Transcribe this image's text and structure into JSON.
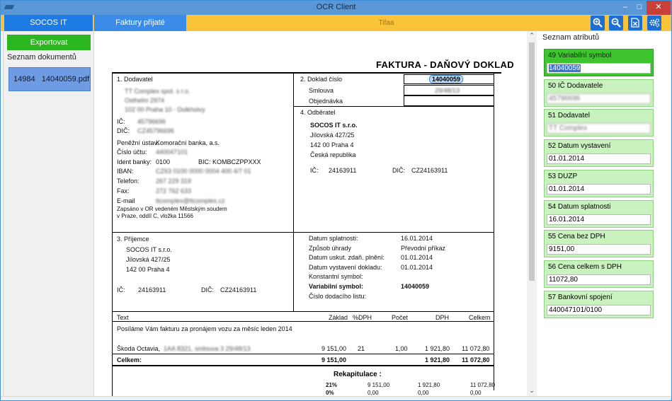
{
  "window": {
    "title": "OCR Client"
  },
  "tabs": [
    "SOCOS IT",
    "Faktury přijaté",
    "Tifaa"
  ],
  "toolbar": {
    "icons": [
      "zoom-in-icon",
      "zoom-out-icon",
      "excel-icon",
      "settings-icon"
    ]
  },
  "left": {
    "export_label": "Exportovat",
    "list_header": "Seznam dokumentů",
    "documents": [
      {
        "id": "14984",
        "name": "14040059.pdf"
      }
    ]
  },
  "invoice": {
    "title": "FAKTURA - DAŇOVÝ DOKLAD",
    "sec1": "1. Dodavatel",
    "sup_name": "TT Complex spol. s r.o.",
    "sup_street": "Osthelm 2974",
    "sup_city": "102 00 Praha 10 - Dolkholvy",
    "ic_lbl": "IČ:",
    "sup_ic": "45796696",
    "dic_lbl": "DIČ:",
    "sup_dic": "CZ45796696",
    "bank_lbl": "Peněžní ústav:",
    "bank_val": "Komorační banka, a.s.",
    "acc_lbl": "Číslo účtu:",
    "acc_val": "440047101",
    "ident_lbl": "Ident banky:",
    "ident_val": "0100",
    "bic_lbl": "BIC:",
    "bic_val": "KOMBCZPPXXX",
    "iban_lbl": "IBAN:",
    "iban_val": "CZ63 0100 0000 0004 400 4/7 01",
    "tel_lbl": "Telefon:",
    "tel_val": "267 229 319",
    "fax_lbl": "Fax:",
    "fax_val": "272 762 633",
    "mail_lbl": "E-mail",
    "mail_val": "ttcomplex@ttcomplex.cz",
    "reg1": "Zapsáno v OR vedeném Městským soudem",
    "reg2": "v Praze, oddíl C, vložka 11566",
    "sec2": "2. Doklad číslo",
    "doc_no": "14040059",
    "smlouva": "Smlouva",
    "smlouva_val": "29/48/13",
    "objednavka": "Objednávka",
    "sec4": "4. Odběratel",
    "cust_name": "SOCOS IT s.r.o.",
    "cust_street": "Jílovská 427/25",
    "cust_city": "142 00      Praha 4",
    "cust_country": "Česká republika",
    "cust_ic_lbl": "IČ:",
    "cust_ic": "24163911",
    "cust_dic_lbl": "DIČ:",
    "cust_dic": "CZ24163911",
    "sec3": "3. Příjemce",
    "rec_name": "SOCOS IT s.r.o.",
    "rec_street": "Jílovská  427/25",
    "rec_city": "142 00      Praha 4",
    "rec_ic_lbl": "IČ:",
    "rec_ic": "24163911",
    "rec_dic_lbl": "DIČ:",
    "rec_dic": "CZ24163911",
    "pay": [
      {
        "label": "Datum splatnosti:",
        "value": "16.01.2014",
        "bold": false
      },
      {
        "label": "Způsob úhrady",
        "value": "Převodní příkaz",
        "bold": false
      },
      {
        "label": "Datum uskut. zdaň. plnění:",
        "value": "01.01.2014",
        "bold": false
      },
      {
        "label": "Datum vystavení dokladu:",
        "value": "01.01.2014",
        "bold": false
      },
      {
        "label": "Konstantní symbol:",
        "value": "",
        "bold": false
      },
      {
        "label": "Variabilní symbol:",
        "value": "14040059",
        "bold": true
      },
      {
        "label": "Číslo dodacího listu:",
        "value": "",
        "bold": false
      }
    ],
    "cols": {
      "text": "Text",
      "zaklad": "Základ",
      "dph_pct": "%DPH",
      "pocet": "Počet",
      "dph": "DPH",
      "celkem": "Celkem"
    },
    "desc": "Posíláme Vám fakturu za pronájem vozu za měsíc leden 2014",
    "item_name": "Škoda Octavia,",
    "item_blur": "1AA 8321, smlouva 3 29/48/13",
    "item_zaklad": "9 151,00",
    "item_pct": "21",
    "item_pocet": "1,00",
    "item_dph": "1 921,80",
    "item_celkem": "11 072,80",
    "celkem_lbl": "Celkem:",
    "celkem_zaklad": "9 151,00",
    "celkem_dph": "1 921,80",
    "celkem_celkem": "11 072,80",
    "rekap": "Rekapitulace :",
    "rekap_rows": [
      {
        "pct": "21%",
        "zaklad": "9 151,00",
        "dph": "1 921,80",
        "celkem": "11 072,80"
      },
      {
        "pct": "0%",
        "zaklad": "0,00",
        "dph": "0,00",
        "celkem": "0,00"
      }
    ]
  },
  "right": {
    "header": "Seznam atributů",
    "attributes": [
      {
        "label": "49  Variabilní symbol",
        "value": "14040059",
        "active": true,
        "blurred": false
      },
      {
        "label": "50  IČ Dodavatele",
        "value": "45796696",
        "active": false,
        "blurred": true
      },
      {
        "label": "51  Dodavatel",
        "value": "TT Complex",
        "active": false,
        "blurred": true
      },
      {
        "label": "52  Datum vystavení",
        "value": "01.01.2014",
        "active": false,
        "blurred": false
      },
      {
        "label": "53  DUZP",
        "value": "01.01.2014",
        "active": false,
        "blurred": false
      },
      {
        "label": "54  Datum splatnosti",
        "value": "16.01.2014",
        "active": false,
        "blurred": false
      },
      {
        "label": "55  Cena bez DPH",
        "value": "9151,00",
        "active": false,
        "blurred": false
      },
      {
        "label": "56  Cena celkem s DPH",
        "value": "11072,80",
        "active": false,
        "blurred": false
      },
      {
        "label": "57  Bankovní spojení",
        "value": "440047101/0100",
        "active": false,
        "blurred": false
      }
    ]
  }
}
